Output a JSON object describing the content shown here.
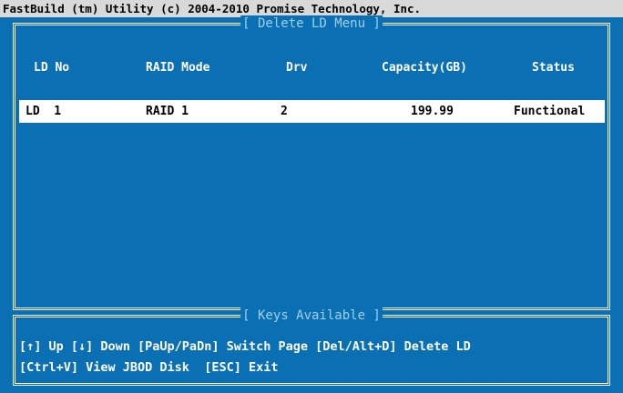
{
  "title_bar": "FastBuild (tm) Utility (c) 2004-2010 Promise Technology, Inc.",
  "main_panel": {
    "title": "[ Delete LD Menu ]",
    "columns": [
      "LD No",
      "RAID Mode",
      "Drv",
      "Capacity(GB)",
      "Status"
    ],
    "rows": [
      {
        "ld_no": "LD  1",
        "raid_mode": "RAID 1",
        "drv": "2",
        "capacity": "199.99",
        "status": "Functional"
      }
    ]
  },
  "keys_panel": {
    "title": "[ Keys Available ]",
    "line1": "[↑] Up [↓] Down [PaUp/PaDn] Switch Page [Del/Alt+D] Delete LD",
    "line2": "[Ctrl+V] View JBOD Disk  [ESC] Exit"
  },
  "colors": {
    "background": "#0a6fb3",
    "title_bar": "#d9d9d9",
    "frame_title": "#9fd0f2",
    "selected_row": "#ffffff"
  }
}
